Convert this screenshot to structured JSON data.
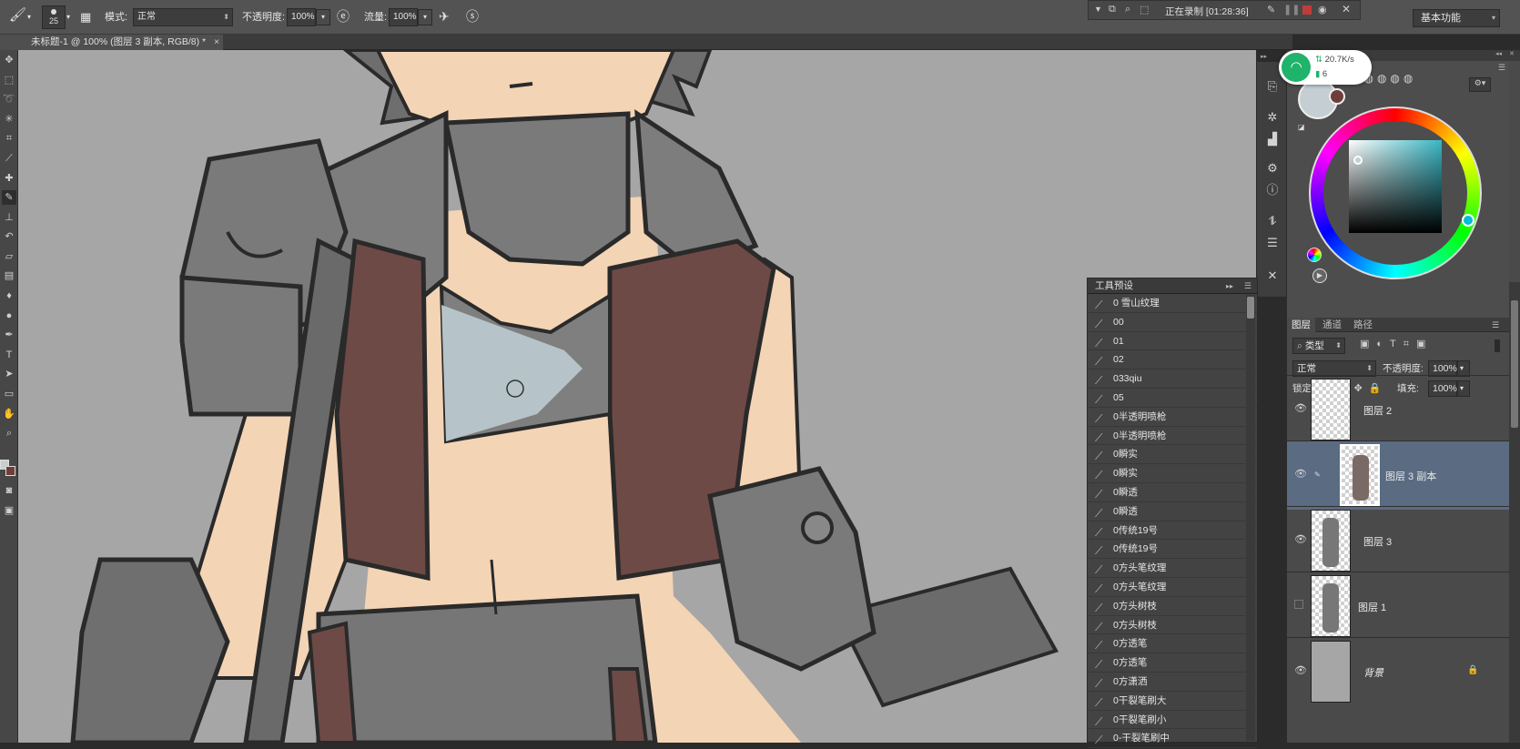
{
  "options_bar": {
    "brush_size": "25",
    "mode_label": "模式:",
    "mode_value": "正常",
    "opacity_label": "不透明度:",
    "opacity_value": "100%",
    "flow_label": "流量:",
    "flow_value": "100%"
  },
  "recording": {
    "status_text": "正在录制 [01:28:36]"
  },
  "workspace": {
    "label": "基本功能"
  },
  "document": {
    "tab_title": "未标题-1 @ 100% (图层 3 副本, RGB/8) *",
    "close_glyph": "×"
  },
  "tool_presets": {
    "title": "工具预设",
    "items": [
      "0 雪山纹理",
      "00",
      "01",
      "02",
      "033qiu",
      "05",
      "0半透明喷枪",
      "0半透明喷枪",
      "0瞬实",
      "0瞬实",
      "0瞬透",
      "0瞬透",
      "0传统19号",
      "0传统19号",
      "0方头笔纹理",
      "0方头笔纹理",
      "0方头树枝",
      "0方头树枝",
      "0方透笔",
      "0方透笔",
      "0方潇洒",
      "0干裂笔刷大",
      "0干裂笔刷小",
      "0-干裂笔刷中"
    ]
  },
  "net_widget": {
    "speed": "20.7K/s",
    "count": "6"
  },
  "colors": {
    "foreground": "#c5cfd3",
    "background": "#6e3f3a",
    "accent_layer": "#5a6b82"
  },
  "layers_panel": {
    "tabs": [
      "图层",
      "通道",
      "路径"
    ],
    "filter_label": "类型",
    "blend_mode": "正常",
    "opacity_label": "不透明度:",
    "opacity_value": "100%",
    "lock_label": "锁定:",
    "fill_label": "填充:",
    "fill_value": "100%",
    "layers": [
      {
        "name": "图层 2",
        "visible": true,
        "selected": false
      },
      {
        "name": "图层 3 副本",
        "visible": true,
        "selected": true
      },
      {
        "name": "图层 3",
        "visible": true,
        "selected": false
      },
      {
        "name": "图层 1",
        "visible": false,
        "selected": false
      },
      {
        "name": "背景",
        "visible": true,
        "selected": false,
        "locked": true
      }
    ]
  }
}
